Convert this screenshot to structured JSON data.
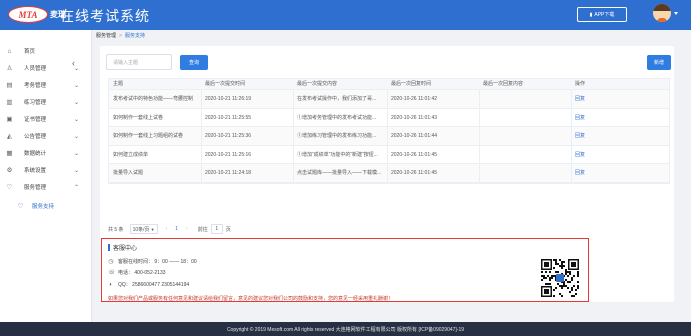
{
  "header": {
    "logo_text": "MTA",
    "logo_cn": "麦瑞",
    "title": "在线考试系统",
    "app_download": "APP下载"
  },
  "sidebar": {
    "items": [
      {
        "label": "首页",
        "icon": "home-icon",
        "has_caret": false
      },
      {
        "label": "人员管理",
        "icon": "user-icon",
        "has_caret": true
      },
      {
        "label": "考务管理",
        "icon": "folder-icon",
        "has_caret": true
      },
      {
        "label": "练习管理",
        "icon": "book-icon",
        "has_caret": true
      },
      {
        "label": "证书管理",
        "icon": "certificate-icon",
        "has_caret": true
      },
      {
        "label": "公告管理",
        "icon": "megaphone-icon",
        "has_caret": true
      },
      {
        "label": "数据统计",
        "icon": "chart-icon",
        "has_caret": true
      },
      {
        "label": "系统设置",
        "icon": "gear-icon",
        "has_caret": true
      },
      {
        "label": "服务管理",
        "icon": "heart-icon",
        "has_caret": true,
        "expanded": true
      }
    ],
    "sub_item": {
      "label": "服务支持",
      "icon": "heart-icon"
    }
  },
  "breadcrumb": {
    "parent": "服务管理",
    "separator": ">",
    "current": "服务支持"
  },
  "toolbar": {
    "search_placeholder": "请输入主题",
    "query_label": "查询",
    "add_label": "新增"
  },
  "table": {
    "columns": [
      "主题",
      "最后一次提交时间",
      "最后一次提交内容",
      "最后一次回复时间",
      "最后一次回复内容",
      "操作"
    ],
    "rows": [
      {
        "subject": "发布考试中的特色功能——弯腰控制",
        "submit_time": "2020-10-21 11:26:19",
        "submit_content": "在发布考试操作中，我们添加了哥...",
        "reply_time": "2020-10-26 11:01:42",
        "reply_content": "",
        "action": "回复"
      },
      {
        "subject": "如何制作一套线上试卷",
        "submit_time": "2020-10-21 11:25:55",
        "submit_content": "①增加考务管理中的发布考试功能...",
        "reply_time": "2020-10-26 11:01:43",
        "reply_content": "",
        "action": "回复"
      },
      {
        "subject": "如何制作一套线上习题组的试卷",
        "submit_time": "2020-10-21 11:25:36",
        "submit_content": "①增加练习管理中的发布练习功能...",
        "reply_time": "2020-10-26 11:01:44",
        "reply_content": "",
        "action": "回复"
      },
      {
        "subject": "如何建立成绩单",
        "submit_time": "2020-10-21 11:25:16",
        "submit_content": "①增加“成绩单”功能中的“新建”按钮...",
        "reply_time": "2020-10-26 11:01:45",
        "reply_content": "",
        "action": "回复"
      },
      {
        "subject": "批量导入试题",
        "submit_time": "2020-10-21 11:24:18",
        "submit_content": "点击试题库——批量导入——下载模...",
        "reply_time": "2020-10-26 11:01:45",
        "reply_content": "",
        "action": "回复"
      }
    ]
  },
  "pagination": {
    "total": "共 5 条",
    "page_size": "10条/页",
    "prev": "‹",
    "current_page": "1",
    "next": "›",
    "goto_label": "前往",
    "goto_value": "1",
    "page_unit": "页"
  },
  "service": {
    "title": "客服中心",
    "hours": "客服在线时间：  9：00 —— 18：00",
    "phone": "电话：  400-052-2133",
    "qq": "QQ：  2586600477 2305144194",
    "note": "如果您对我们产品或服务有任何意见和建议请给我们留言，意见的建议您对我们公司的鼓励和支持，您的意见一经采用重礼酬谢！"
  },
  "footer": {
    "text": "Copyright © 2019 Mesoft.com All rights reserved 大连格网软件工程有限公司 版权所有 [ICP备09029047]-19"
  },
  "colors": {
    "primary": "#2f6fcf",
    "button": "#2f7de1",
    "highlight_border": "#e53935",
    "footer_bg": "#273042"
  }
}
